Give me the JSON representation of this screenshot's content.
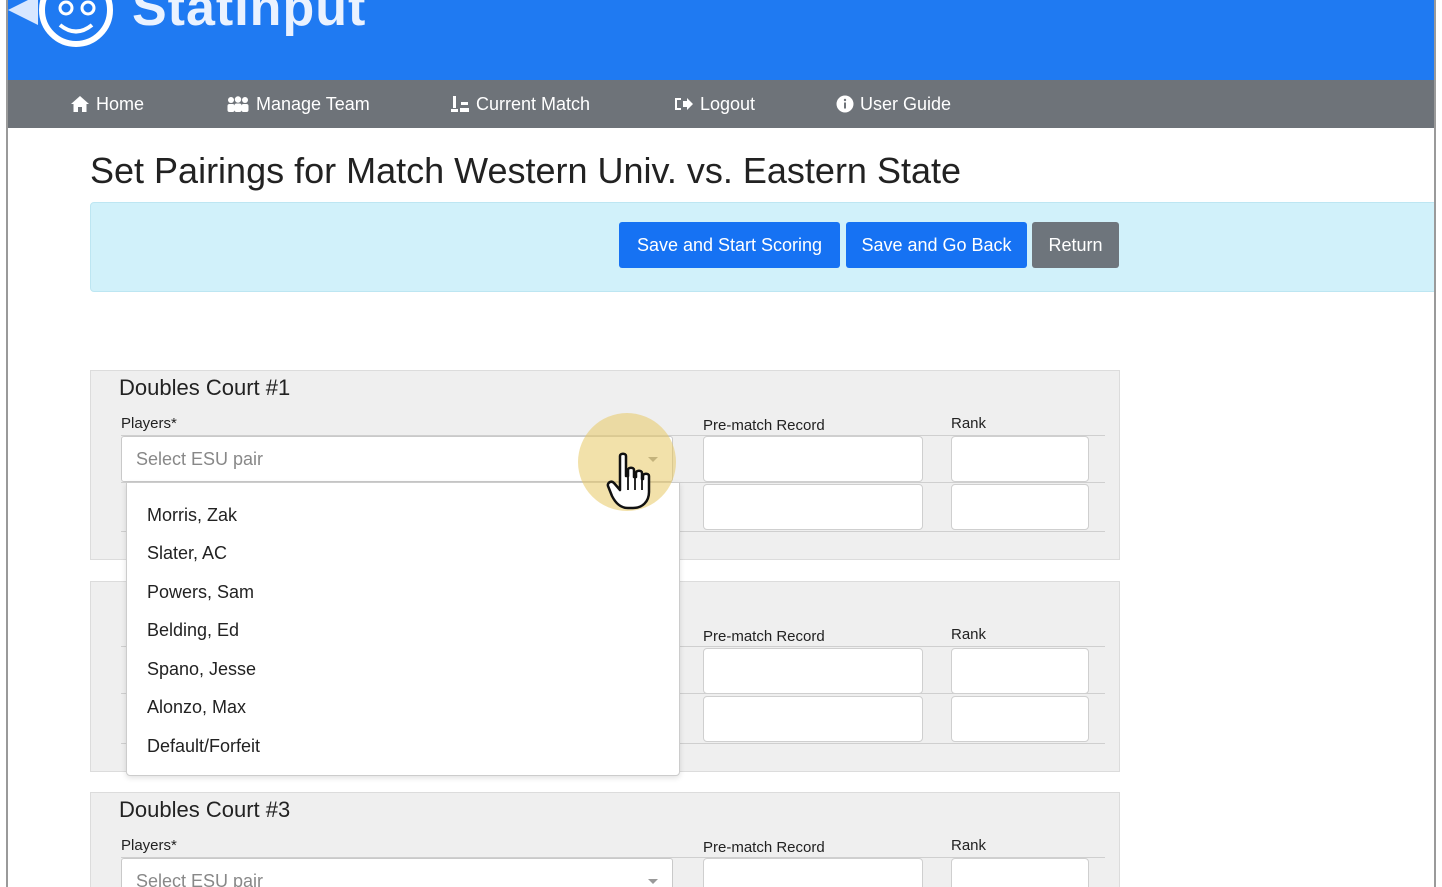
{
  "brand": {
    "name": "StatInput"
  },
  "nav": {
    "items": [
      {
        "label": "Home",
        "icon": "home-icon"
      },
      {
        "label": "Manage Team",
        "icon": "users-icon"
      },
      {
        "label": "Current Match",
        "icon": "chess-icon"
      },
      {
        "label": "Logout",
        "icon": "logout-icon"
      },
      {
        "label": "User Guide",
        "icon": "info-icon"
      }
    ]
  },
  "page": {
    "title": "Set Pairings for Match Western Univ. vs. Eastern State"
  },
  "actions": {
    "save_start": "Save and Start Scoring",
    "save_back": "Save and Go Back",
    "return": "Return"
  },
  "labels": {
    "players": "Players*",
    "record": "Pre-match Record",
    "rank": "Rank"
  },
  "courts": [
    {
      "title": "Doubles Court #1",
      "select_placeholder": "Select ESU pair"
    },
    {
      "title": "",
      "select_placeholder": ""
    },
    {
      "title": "Doubles Court #3",
      "select_placeholder": "Select ESU pair"
    }
  ],
  "dropdown": {
    "options": [
      "Morris, Zak",
      "Slater, AC",
      "Powers, Sam",
      "Belding, Ed",
      "Spano, Jesse",
      "Alonzo, Max",
      "Default/Forfeit"
    ]
  },
  "colors": {
    "brand": "#1f7af2",
    "nav": "#6e7379",
    "primary": "#1672f3",
    "secondary": "#6e757c",
    "panel": "#d1f1fa"
  }
}
